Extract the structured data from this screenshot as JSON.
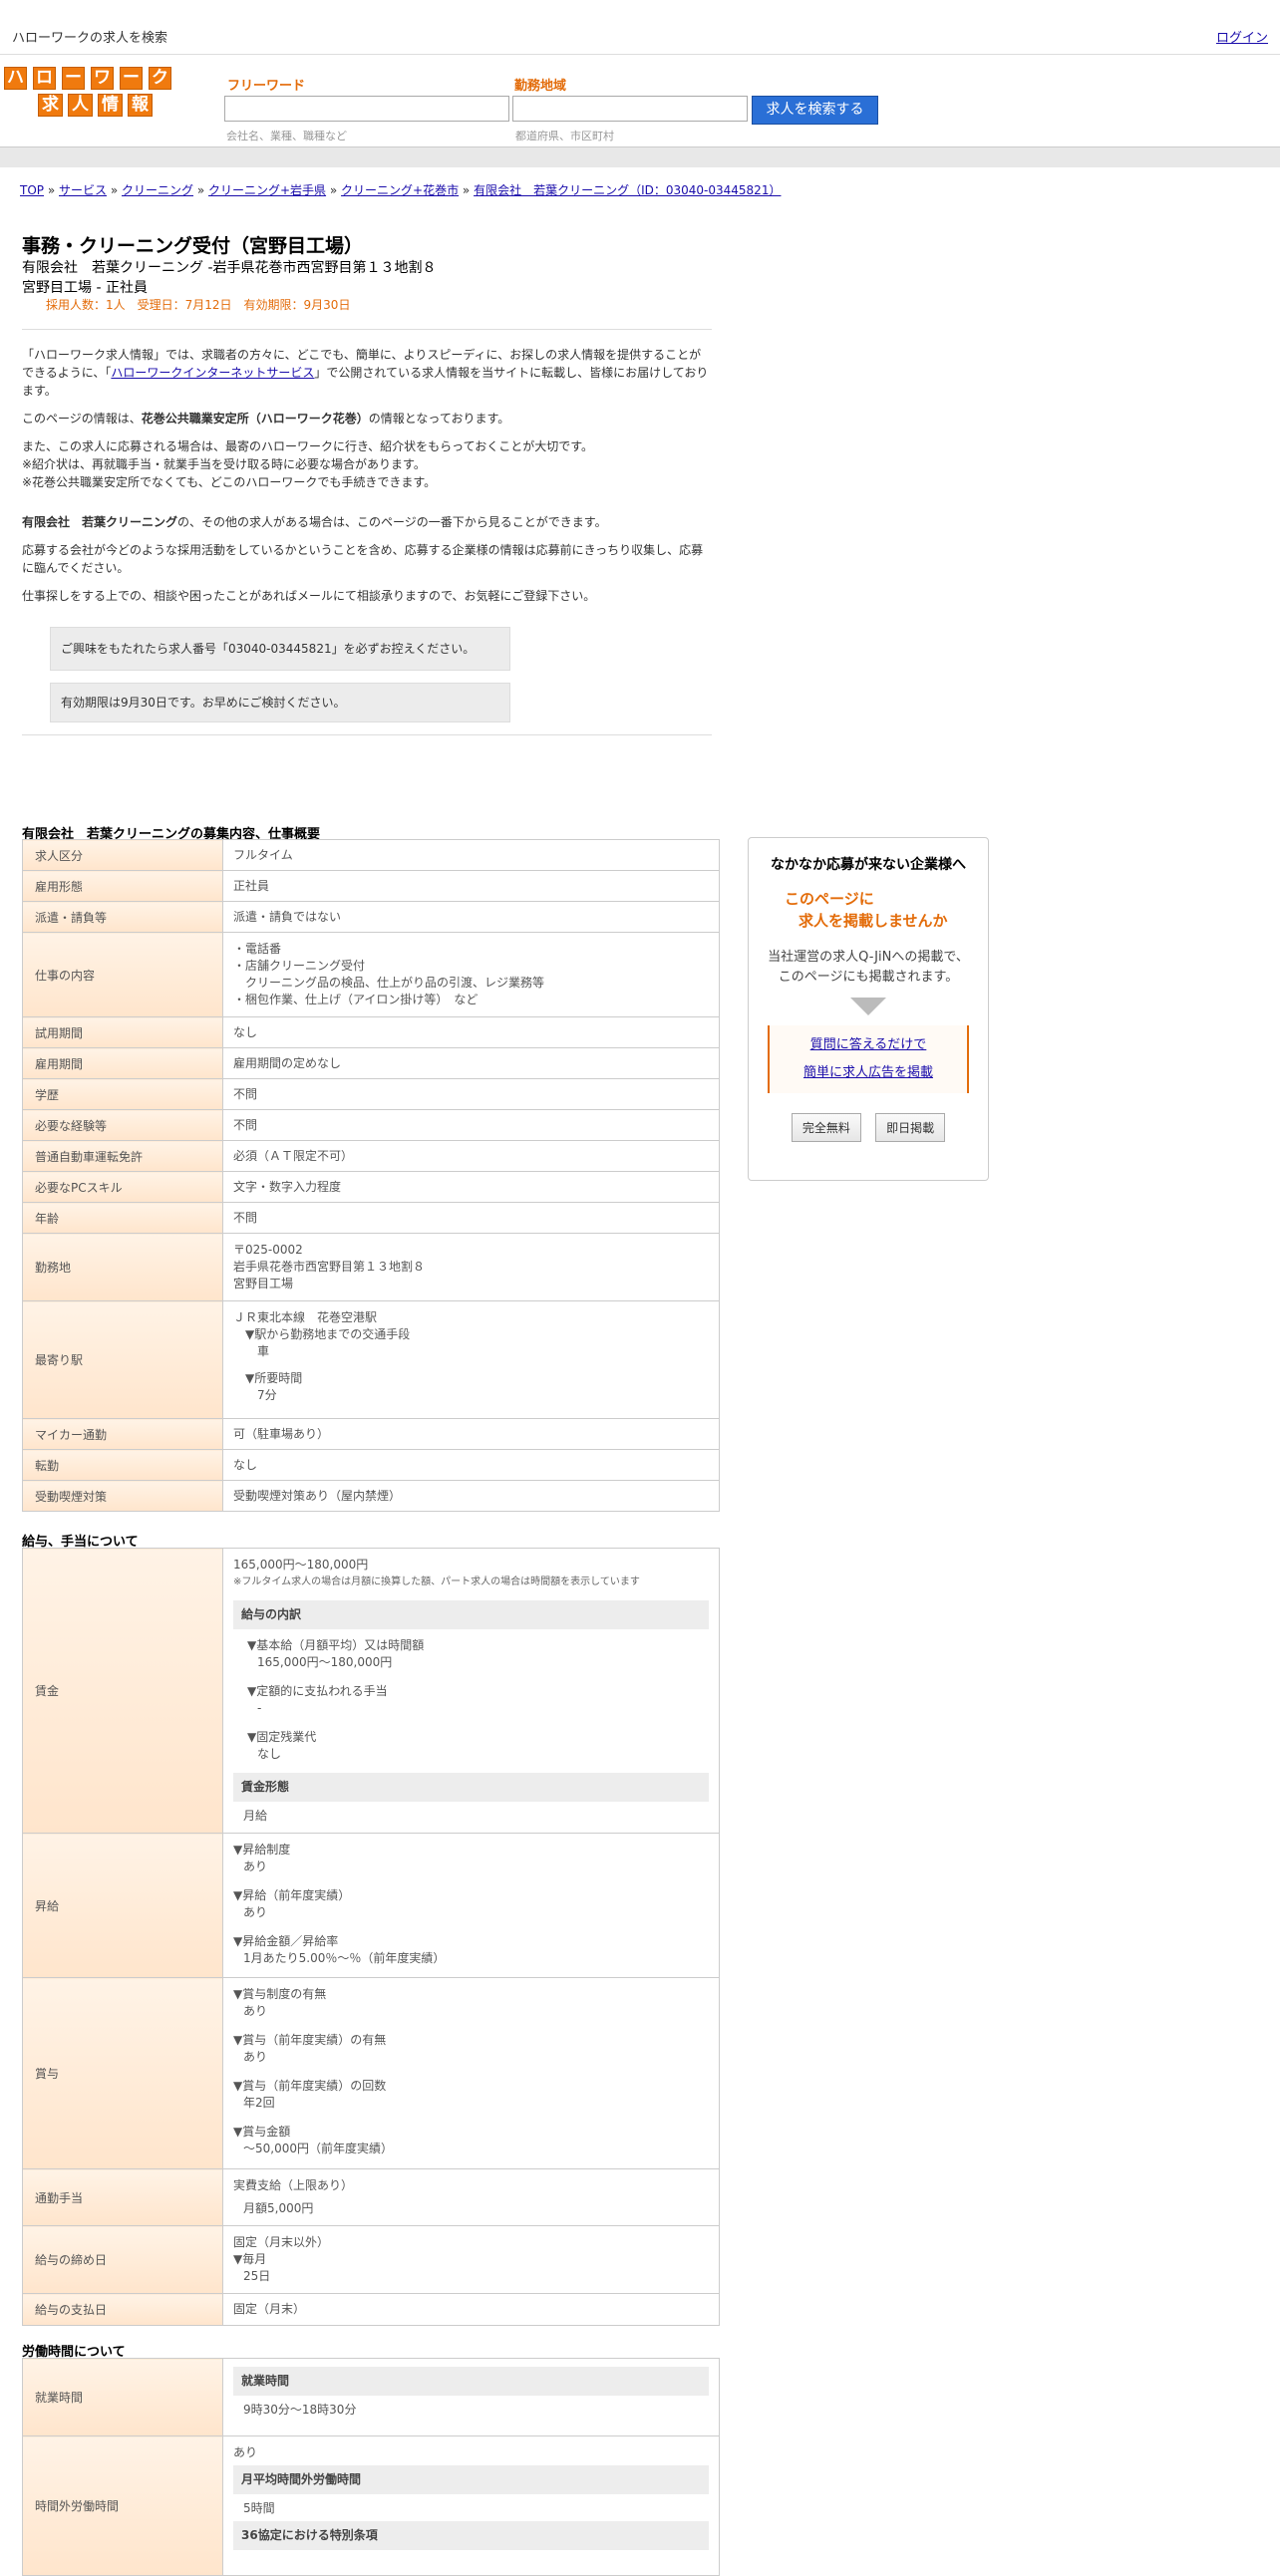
{
  "header": {
    "title": "ハローワークの求人を検索",
    "login": "ログイン"
  },
  "logo": {
    "row1": [
      "ハ",
      "ロ",
      "ー",
      "ワ",
      "ー",
      "ク"
    ],
    "row2": [
      "求",
      "人",
      "情",
      "報"
    ]
  },
  "search": {
    "freeword_label": "フリーワード",
    "freeword_hint": "会社名、業種、職種など",
    "area_label": "勤務地域",
    "area_hint": "都道府県、市区町村",
    "button": "求人を検索する"
  },
  "breadcrumb": [
    "TOP",
    "サービス",
    "クリーニング",
    "クリーニング+岩手県",
    "クリーニング+花巻市",
    "有限会社　若葉クリーニング（ID：03040-03445821）"
  ],
  "job": {
    "title": "事務・クリーニング受付（宮野目工場）",
    "company_line": "有限会社　若葉クリーニング -岩手県花巻市西宮野目第１３地割８",
    "site_line": "宮野目工場 - 正社員",
    "meta": "採用人数：1人　受理日：7月12日　有効期限：9月30日"
  },
  "intro": {
    "p1a": "「ハローワーク求人情報」では、求職者の方々に、どこでも、簡単に、よりスピーディに、お探しの求人情報を提供することができるように、「",
    "p1link": "ハローワークインターネットサービス",
    "p1b": "」で公開されている求人情報を当サイトに転載し、皆様にお届けしております。",
    "p2a": "このページの情報は、",
    "p2b": "花巻公共職業安定所（ハローワーク花巻）",
    "p2c": "の情報となっております。",
    "p3": "また、この求人に応募される場合は、最寄のハローワークに行き、紹介状をもらっておくことが大切です。",
    "p4": "※紹介状は、再就職手当・就業手当を受け取る時に必要な場合があります。",
    "p5": "※花巻公共職業安定所でなくても、どこのハローワークでも手続きできます。",
    "p6a": "有限会社　若葉クリーニング",
    "p6b": "の、その他の求人がある場合は、このページの一番下から見ることができます。",
    "p7": "応募する会社が今どのような採用活動をしているかということを含め、応募する企業様の情報は応募前にきっちり収集し、応募に臨んでください。",
    "p8": "仕事探しをする上での、相談や困ったことがあればメールにて相談承りますので、お気軽にご登録下さい。",
    "notice1": "ご興味をもたれたら求人番号「03040-03445821」を必ずお控えください。",
    "notice2": "有効期限は9月30日です。お早めにご検討ください。"
  },
  "overview": {
    "title": "有限会社　若葉クリーニングの募集内容、仕事概要",
    "rows": [
      {
        "k": "求人区分",
        "v": "フルタイム"
      },
      {
        "k": "雇用形態",
        "v": "正社員"
      },
      {
        "k": "派遣・請負等",
        "v": "派遣・請負ではない"
      },
      {
        "k": "仕事の内容",
        "v": [
          "・電話番",
          "・店舗クリーニング受付",
          "　クリーニング品の検品、仕上がり品の引渡、レジ業務等",
          "・梱包作業、仕上げ（アイロン掛け等）　など"
        ]
      },
      {
        "k": "試用期間",
        "v": "なし"
      },
      {
        "k": "雇用期間",
        "v": "雇用期間の定めなし"
      },
      {
        "k": "学歴",
        "v": "不問"
      },
      {
        "k": "必要な経験等",
        "v": "不問"
      },
      {
        "k": "普通自動車運転免許",
        "v": "必須（ＡＴ限定不可）"
      },
      {
        "k": "必要なPCスキル",
        "v": "文字・数字入力程度"
      },
      {
        "k": "年齢",
        "v": "不問"
      },
      {
        "k": "勤務地",
        "v": [
          "〒025-0002",
          "岩手県花巻市西宮野目第１３地割８",
          "宮野目工場"
        ]
      },
      {
        "k": "最寄り駅",
        "v": [
          "ＪＲ東北本線　花巻空港駅",
          "　▼駅から勤務地までの交通手段",
          "　　車",
          "",
          "　▼所要時間",
          "　　7分"
        ]
      },
      {
        "k": "マイカー通勤",
        "v": "可（駐車場あり）"
      },
      {
        "k": "転勤",
        "v": "なし"
      },
      {
        "k": "受動喫煙対策",
        "v": "受動喫煙対策あり（屋内禁煙）"
      }
    ]
  },
  "salary": {
    "title": "給与、手当について",
    "wage_label": "賃金",
    "wage_range": "165,000円〜180,000円",
    "wage_note": "※フルタイム求人の場合は月額に換算した額、パート求人の場合は時間額を表示しています",
    "breakdown_head": "給与の内訳",
    "base_label": "▼基本給（月額平均）又は時間額",
    "base_value": "165,000円〜180,000円",
    "fixed_label": "▼定額的に支払われる手当",
    "fixed_value": "-",
    "overtime_label": "▼固定残業代",
    "overtime_value": "なし",
    "form_head": "賃金形態",
    "form_value": "月給",
    "raise_label": "昇給",
    "raise": [
      "▼昇給制度",
      "あり",
      "▼昇給（前年度実績）",
      "あり",
      "▼昇給金額／昇給率",
      "1月あたり5.00％〜％（前年度実績）"
    ],
    "bonus_label": "賞与",
    "bonus": [
      "▼賞与制度の有無",
      "あり",
      "▼賞与（前年度実績）の有無",
      "あり",
      "▼賞与（前年度実績）の回数",
      "年2回",
      "▼賞与金額",
      "〜50,000円（前年度実績）"
    ],
    "commute_label": "通勤手当",
    "commute": [
      "実費支給（上限あり）",
      "月額5,000円"
    ],
    "closing_label": "給与の締め日",
    "closing": [
      "固定（月末以外）",
      "▼毎月",
      "25日"
    ],
    "payday_label": "給与の支払日",
    "payday": "固定（月末）"
  },
  "labor": {
    "title": "労働時間について",
    "hours_label": "就業時間",
    "hours_head": "就業時間",
    "hours_value": "9時30分〜18時30分",
    "ot_label": "時間外労働時間",
    "ot_value": "あり",
    "ot_head1": "月平均時間外労働時間",
    "ot_value1": "5時間",
    "ot_head2": "36協定における特別条項"
  },
  "ad": {
    "h1": "なかなか応募が来ない企業様へ",
    "h2a": "このページに",
    "h2b": "求人を掲載しませんか",
    "p1": "当社運営の求人Q-JiNへの掲載で、",
    "p2": "このページにも掲載されます。",
    "link1": "質問に答えるだけで",
    "link2": "簡単に求人広告を掲載",
    "btn1": "完全無料",
    "btn2": "即日掲載"
  },
  "colors": {
    "accent": "#e36c0a",
    "button": "#2a6fd6",
    "th_bg": "#ffe5cc"
  }
}
